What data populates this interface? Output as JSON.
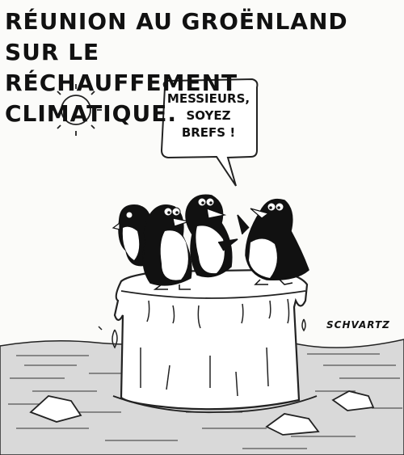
{
  "caption": {
    "line1": "Réunion au Groënland sur le",
    "line2": "réchauffement climatique."
  },
  "speech_bubble": {
    "line1": "Messieurs,",
    "line2": "soyez",
    "line3": "brefs !"
  },
  "signature": "SCHVARTZ"
}
